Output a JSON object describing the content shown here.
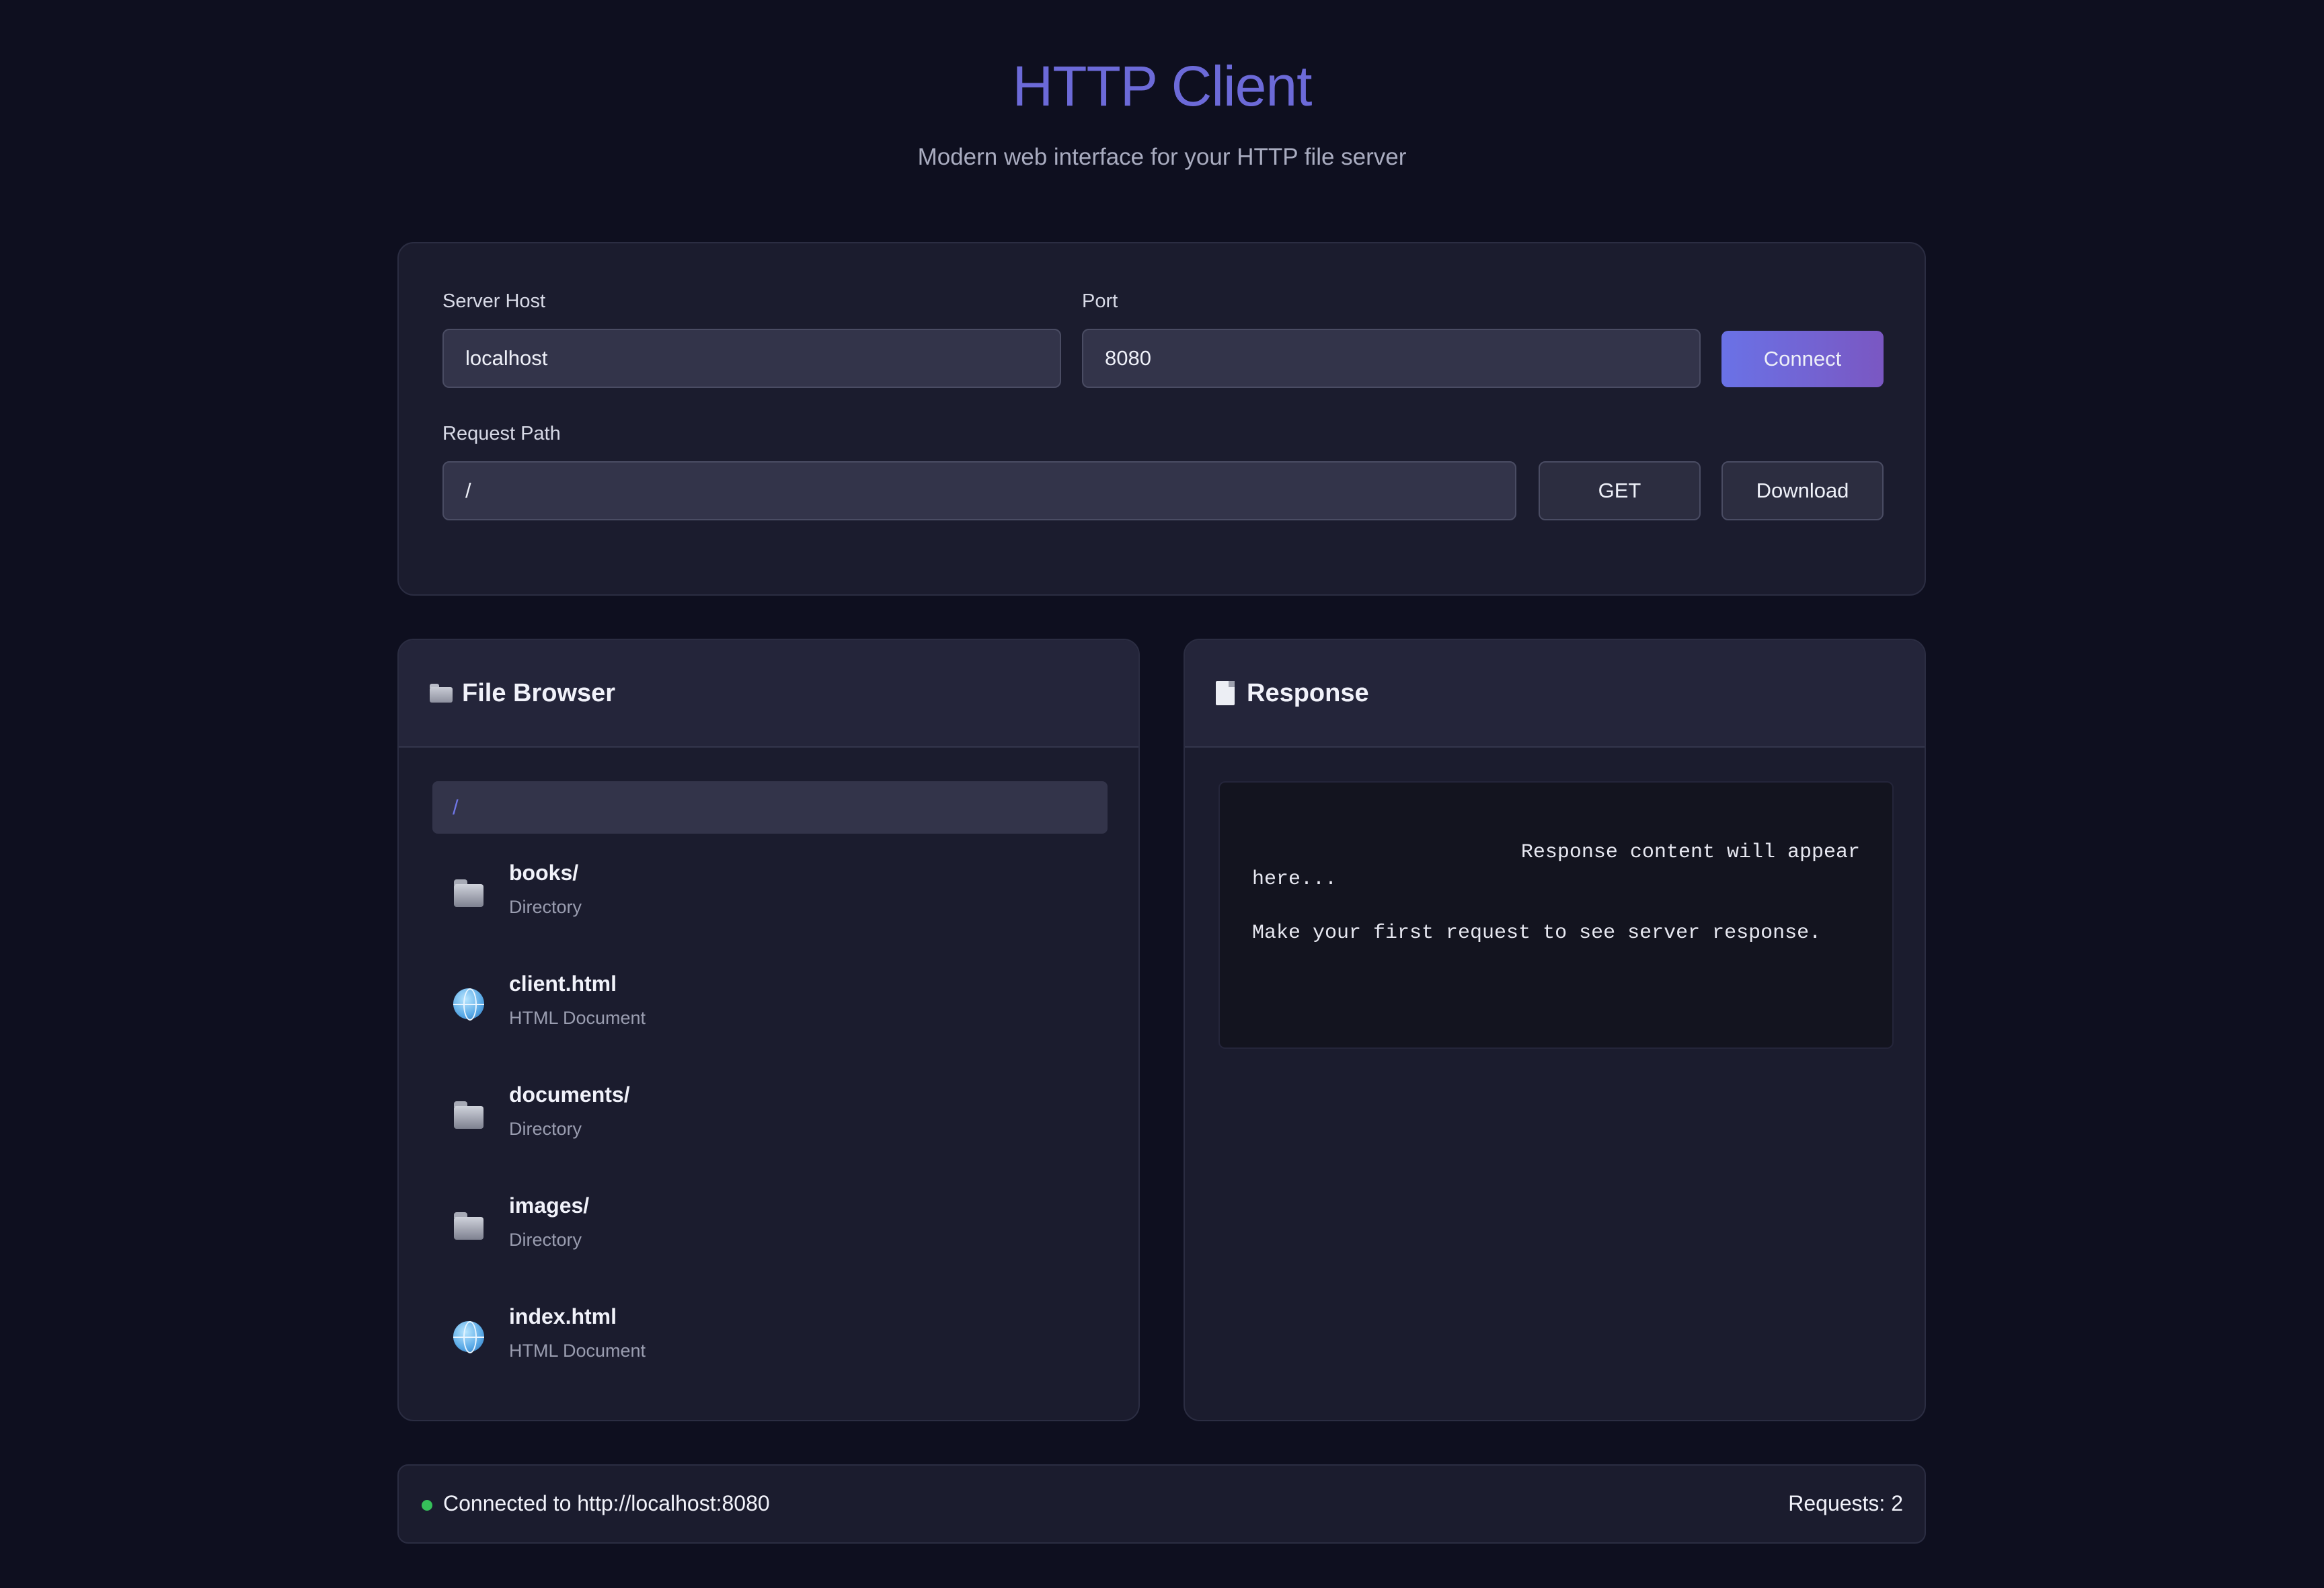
{
  "header": {
    "title": "HTTP Client",
    "subtitle": "Modern web interface for your HTTP file server"
  },
  "connection": {
    "host_label": "Server Host",
    "host_value": "localhost",
    "port_label": "Port",
    "port_value": "8080",
    "connect_label": "Connect",
    "path_label": "Request Path",
    "path_value": "/",
    "get_label": "GET",
    "download_label": "Download"
  },
  "file_browser": {
    "title": "File Browser",
    "current_path": "/",
    "items": [
      {
        "name": "books/",
        "type": "Directory",
        "icon": "folder-icon"
      },
      {
        "name": "client.html",
        "type": "HTML Document",
        "icon": "globe-icon"
      },
      {
        "name": "documents/",
        "type": "Directory",
        "icon": "folder-icon"
      },
      {
        "name": "images/",
        "type": "Directory",
        "icon": "folder-icon"
      },
      {
        "name": "index.html",
        "type": "HTML Document",
        "icon": "globe-icon"
      }
    ]
  },
  "response": {
    "title": "Response",
    "line1": "Response content will appear",
    "line2": "here...",
    "line3": "Make your first request to see server response."
  },
  "status": {
    "connection_text": "Connected to http://localhost:8080",
    "requests_text": "Requests: 2",
    "status_color": "#36c05a"
  },
  "colors": {
    "accent": "#6c6ad8",
    "background": "#0e0f1f",
    "card": "#1b1c2e"
  }
}
